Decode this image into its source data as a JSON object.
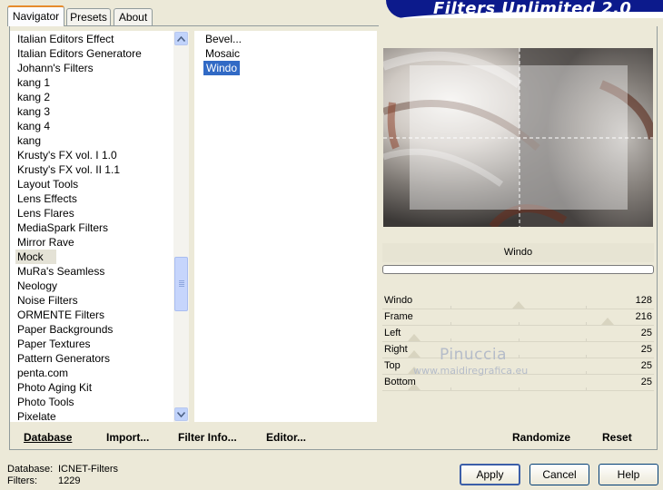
{
  "tabs": [
    {
      "label": "Navigator"
    },
    {
      "label": "Presets"
    },
    {
      "label": "About"
    }
  ],
  "banner_title": "Filters Unlimited 2.0",
  "categories": [
    "Italian Editors Effect",
    "Italian Editors Generatore",
    "Johann's Filters",
    "kang 1",
    "kang 2",
    "kang 3",
    "kang 4",
    "kang",
    "Krusty's FX vol. I 1.0",
    "Krusty's FX vol. II 1.1",
    "Layout Tools",
    "Lens Effects",
    "Lens Flares",
    "MediaSpark Filters",
    "Mirror Rave",
    "Mock",
    "MuRa's Seamless",
    "Neology",
    "Noise Filters",
    "ORMENTE Filters",
    "Paper Backgrounds",
    "Paper Textures",
    "Pattern Generators",
    "penta.com",
    "Photo Aging Kit",
    "Photo Tools",
    "Pixelate"
  ],
  "filters": [
    "Bevel...",
    "Mosaic",
    "Windo"
  ],
  "selected_filter": "Windo",
  "params": [
    {
      "name": "Windo",
      "value": "128"
    },
    {
      "name": "Frame",
      "value": "216"
    },
    {
      "name": "Left",
      "value": "25"
    },
    {
      "name": "Right",
      "value": "25"
    },
    {
      "name": "Top",
      "value": "25"
    },
    {
      "name": "Bottom",
      "value": "25"
    }
  ],
  "watermark": {
    "name": "Pinuccia",
    "url": "www.maidiregrafica.eu"
  },
  "toolbar": {
    "database": "Database",
    "import": "Import...",
    "filter_info": "Filter Info...",
    "editor": "Editor...",
    "randomize": "Randomize",
    "reset": "Reset"
  },
  "buttons": {
    "apply": "Apply",
    "cancel": "Cancel",
    "help": "Help"
  },
  "status": {
    "database_label": "Database:",
    "database_value": "ICNET-Filters",
    "filters_label": "Filters:",
    "filters_value": "1229"
  },
  "colors": {
    "banner": "#0c1a8c",
    "selection": "#316ac5",
    "tab_active_border": "#e68b2c",
    "window_bg": "#ece9d8"
  },
  "icons": {
    "scroll_up": "triangle-up-icon",
    "scroll_down": "triangle-down-icon"
  }
}
